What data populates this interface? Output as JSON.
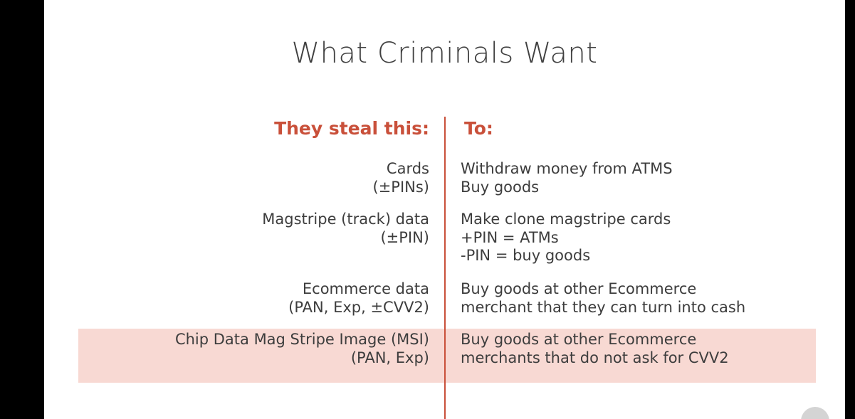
{
  "title": "What Criminals Want",
  "headers": {
    "left": "They steal this:",
    "right": "To:"
  },
  "rows": [
    {
      "steal": [
        "Cards",
        "(±PINs)"
      ],
      "to": [
        "Withdraw money from ATMS",
        "Buy goods"
      ]
    },
    {
      "steal": [
        "Magstripe (track) data",
        "(±PIN)"
      ],
      "to": [
        "Make clone magstripe cards",
        "+PIN = ATMs",
        "-PIN = buy goods"
      ]
    },
    {
      "steal": [
        "Ecommerce data",
        "(PAN, Exp, ±CVV2)"
      ],
      "to": [
        "Buy goods at other Ecommerce",
        "merchant that they can turn into cash"
      ]
    },
    {
      "steal": [
        "Chip Data Mag Stripe Image (MSI)",
        "(PAN, Exp)"
      ],
      "to": [
        "Buy goods at other Ecommerce",
        "merchants that do not ask for CVV2"
      ],
      "highlighted": true
    }
  ],
  "colors": {
    "accent": "#c9503a",
    "highlight": "#f8d9d3",
    "text": "#3d3d3d",
    "title": "#404040"
  }
}
